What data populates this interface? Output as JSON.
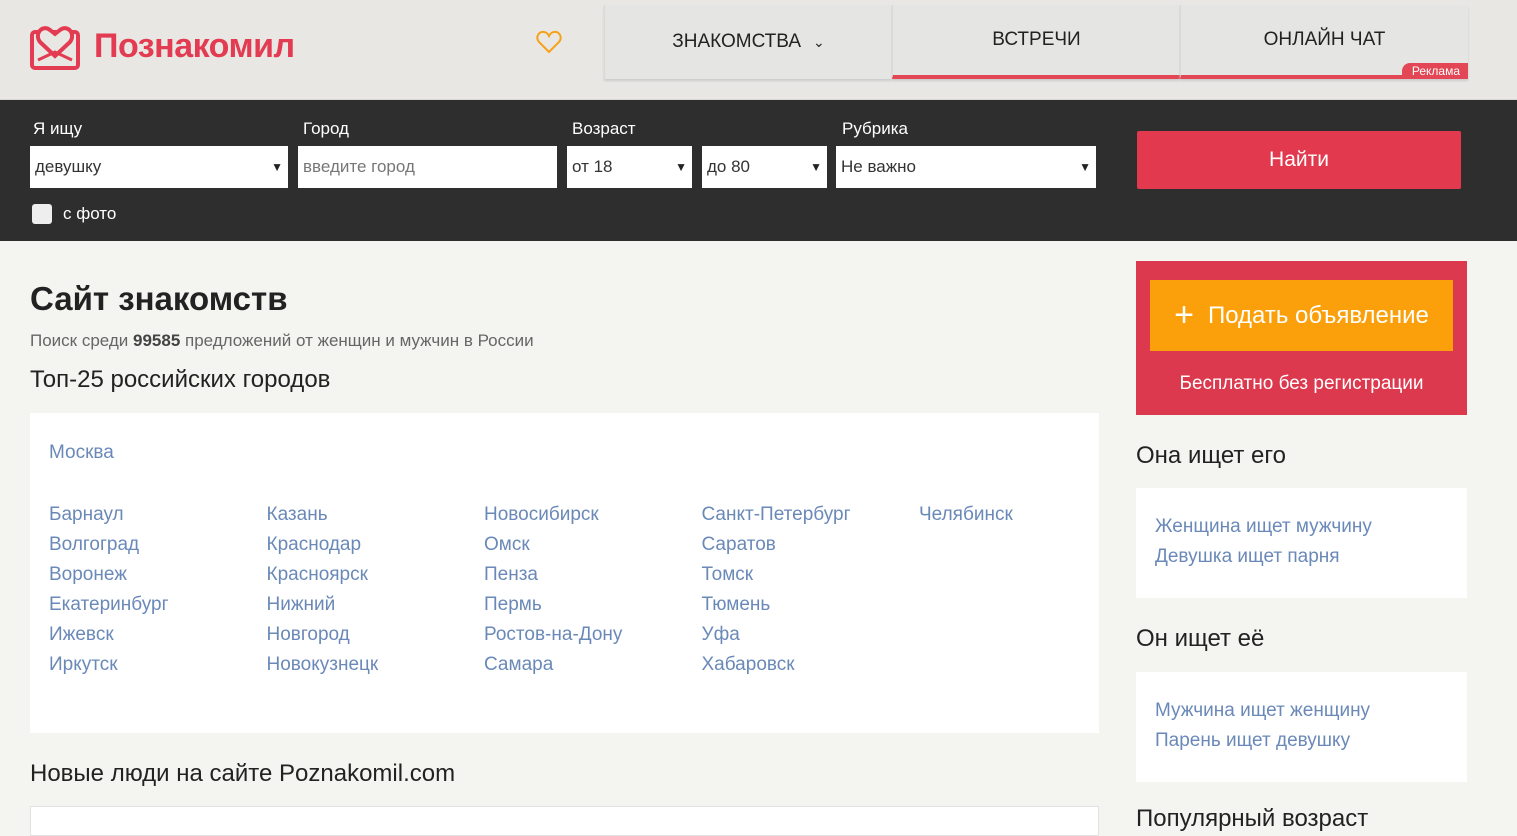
{
  "header": {
    "logo": "Познакомил",
    "nav": [
      {
        "label": "ЗНАКОМСТВА"
      },
      {
        "label": "ВСТРЕЧИ"
      },
      {
        "label": "ОНЛАЙН ЧАТ",
        "badge": "Реклама"
      }
    ]
  },
  "search": {
    "seek_label": "Я ищу",
    "seek_value": "девушку",
    "city_label": "Город",
    "city_placeholder": "введите город",
    "age_label": "Возраст",
    "age_from": "от 18",
    "age_to": "до 80",
    "rubric_label": "Рубрика",
    "rubric_value": "Не важно",
    "find": "Найти",
    "photo": "с фото"
  },
  "main": {
    "title": "Сайт знакомств",
    "sub_prefix": "Поиск среди ",
    "count": "99585",
    "sub_suffix": " предложений от женщин и мужчин в России",
    "top_title": "Топ-25 российских городов",
    "top_city": "Москва",
    "columns": [
      [
        "Барнаул",
        "Волгоград",
        "Воронеж",
        "Екатеринбург",
        "Ижевск",
        "Иркутск"
      ],
      [
        "Казань",
        "Краснодар",
        "Красноярск",
        "Нижний",
        "Новгород",
        "Новокузнецк"
      ],
      [
        "Новосибирск",
        "Омск",
        "Пенза",
        "Пермь",
        "Ростов-на-Дону",
        "Самара"
      ],
      [
        "Санкт-Петербург",
        "Саратов",
        "Томск",
        "Тюмень",
        "Уфа",
        "Хабаровск"
      ],
      [
        "Челябинск"
      ]
    ],
    "new_title": "Новые люди на сайте Poznakomil.com"
  },
  "sidebar": {
    "promo_button": "Подать объявление",
    "promo_sub": "Бесплатно без регистрации",
    "she_title": "Она ищет его",
    "she_links": [
      "Женщина ищет мужчину",
      "Девушка ищет парня"
    ],
    "he_title": "Он ищет её",
    "he_links": [
      "Мужчина ищет женщину",
      "Парень ищет девушку"
    ],
    "age_title": "Популярный возраст"
  },
  "colors": {
    "brand": "#e33b51",
    "accent": "#fba00b",
    "link": "#6a89b8"
  }
}
